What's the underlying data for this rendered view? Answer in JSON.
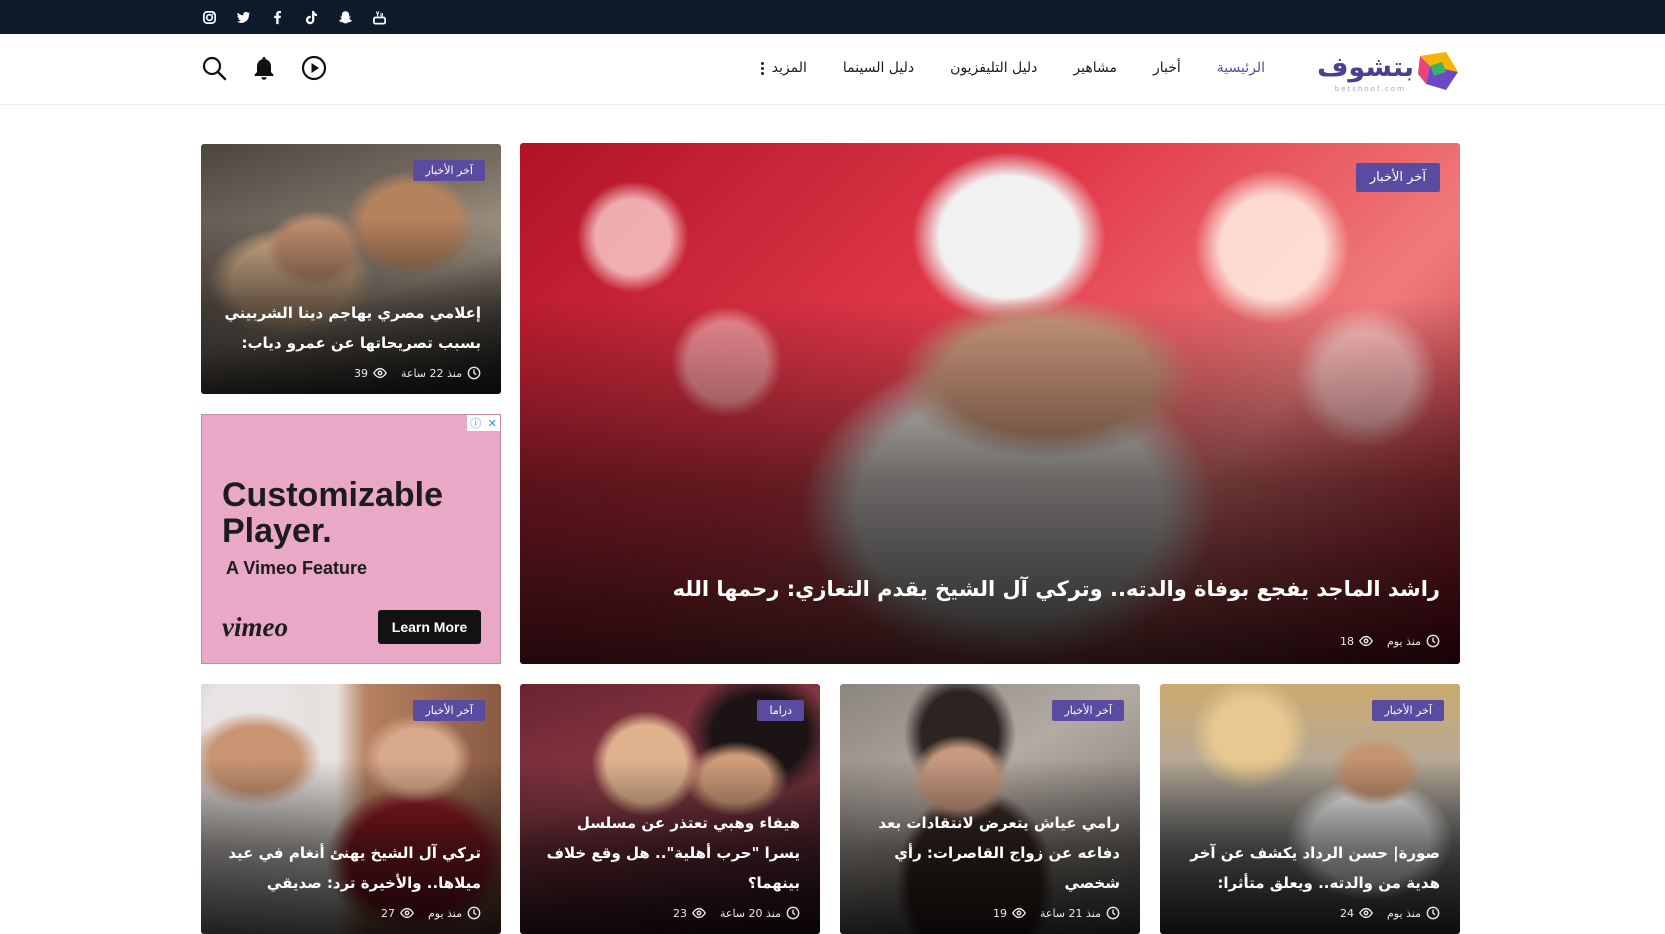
{
  "social": [
    "instagram-icon",
    "twitter-icon",
    "facebook-icon",
    "tiktok-icon",
    "snapchat-icon",
    "youtube-icon"
  ],
  "brand": {
    "logo_text": "بتشوف",
    "logo_sub": "betshoof.com"
  },
  "nav": {
    "home": "الرئيسية",
    "news": "أخبار",
    "celebs": "مشاهير",
    "tv_guide": "دليل التليفزيون",
    "cinema_guide": "دليل السينما",
    "more": "المزيد"
  },
  "header_icons": [
    "play-icon",
    "bell-icon",
    "search-icon"
  ],
  "featured": {
    "badge": "آخر الأخبار",
    "title": "راشد الماجد يفجع بوفاة والدته.. وتركي آل الشيخ يقدم التعازي: رحمها الله",
    "views": "18",
    "time": "منذ يوم"
  },
  "side_top": {
    "badge": "آخر الأخبار",
    "title": "إعلامي مصري يهاجم دينا الشربيني بسبب تصريحاتها عن عمرو دياب:",
    "views": "39",
    "time": "منذ 22 ساعة"
  },
  "ad": {
    "headline": "Customizable Player.",
    "subline": "A Vimeo Feature",
    "brand": "vimeo",
    "cta": "Learn More"
  },
  "cards": [
    {
      "badge": "آخر الأخبار",
      "title": "صورة| حسن الرداد يكشف عن آخر هدية من والدته.. ويعلق متأثرا:",
      "views": "24",
      "time": "منذ يوم"
    },
    {
      "badge": "آخر الأخبار",
      "title": "رامي عياش يتعرض لانتقادات بعد دفاعه عن زواج القاصرات: رأي شخصي",
      "views": "19",
      "time": "منذ 21 ساعة"
    },
    {
      "badge": "دراما",
      "title": "هيفاء وهبي تعتذر عن مسلسل يسرا \"حرب أهلية\".. هل وقع خلاف بينهما؟",
      "views": "23",
      "time": "منذ 20 ساعة"
    },
    {
      "badge": "آخر الأخبار",
      "title": "تركي آل الشيخ يهنئ أنغام في عيد ميلاها.. والأخيرة ترد: صديقي",
      "views": "27",
      "time": "منذ يوم"
    }
  ]
}
